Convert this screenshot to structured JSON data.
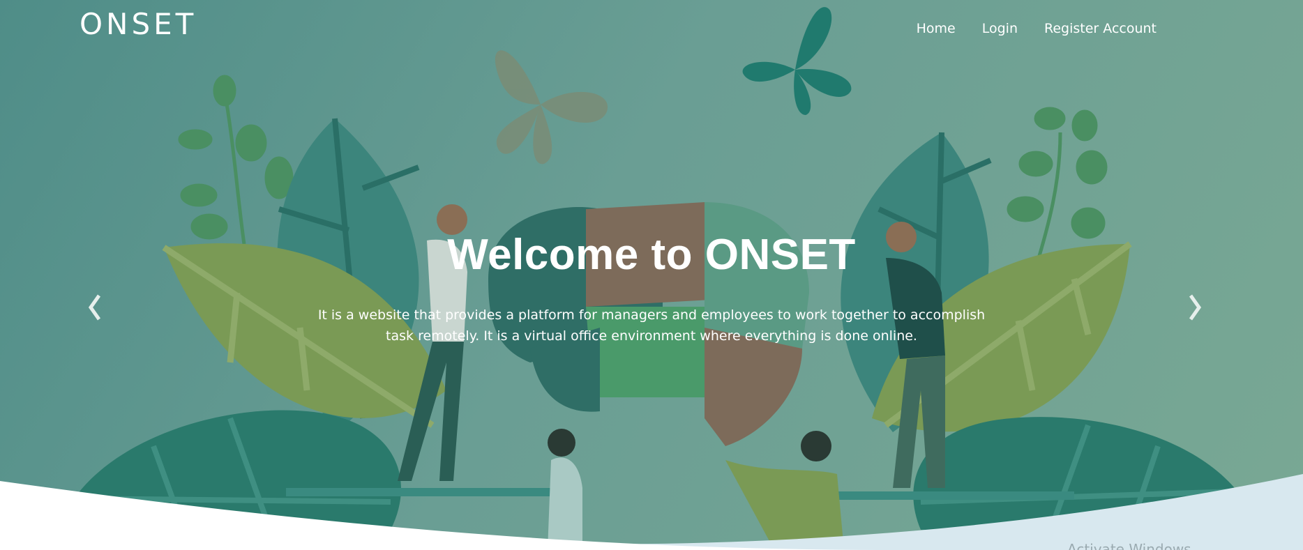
{
  "brand": {
    "name": "ONSET"
  },
  "nav": {
    "items": [
      {
        "label": "Home"
      },
      {
        "label": "Login"
      },
      {
        "label": "Register Account"
      }
    ]
  },
  "hero": {
    "title": "Welcome to ONSET",
    "description": "It is a website that provides a platform for managers and employees to work together to accomplish task remotely. It is a virtual office environment where everything is done online."
  },
  "carousel": {
    "prev_icon": "chevron-left-icon",
    "next_icon": "chevron-right-icon"
  },
  "watermark": {
    "text": "Activate Windows"
  },
  "colors": {
    "overlay": "#5d958c",
    "leaf_dark": "#2e7a72",
    "leaf_olive": "#7d9a52",
    "puzzle_brown": "#7d6b5a",
    "curve_light": "#d8e8ef",
    "text": "#ffffff"
  }
}
